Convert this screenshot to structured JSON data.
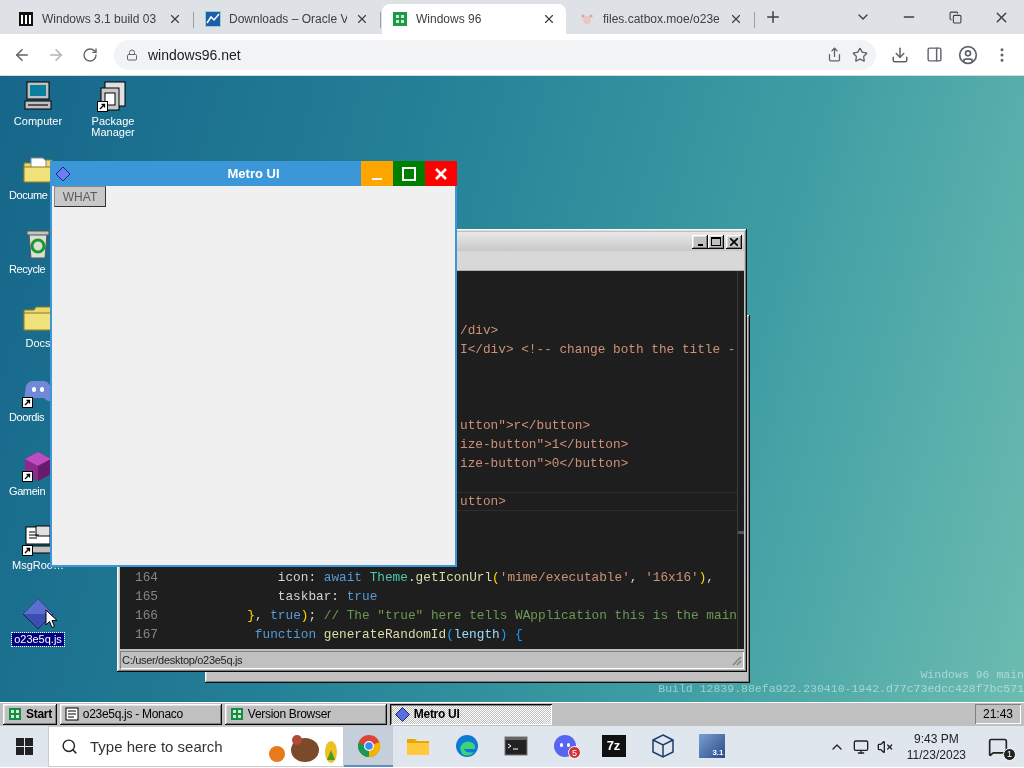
{
  "browser": {
    "tabs": [
      {
        "title": "Windows 3.1 build 03",
        "selected": false,
        "kind": "columns"
      },
      {
        "title": "Downloads – Oracle V",
        "selected": false,
        "kind": "chart"
      },
      {
        "title": "Windows 96",
        "selected": true,
        "kind": "grid"
      },
      {
        "title": "files.catbox.moe/o23e",
        "selected": false,
        "kind": "blob"
      }
    ],
    "url": "windows96.net"
  },
  "desktop": {
    "icons": [
      {
        "label": "Computer",
        "kind": "computer",
        "selected": false,
        "shortcut": false
      },
      {
        "label": "Package Manager",
        "kind": "package",
        "selected": false,
        "shortcut": true
      },
      {
        "label": "Docume",
        "kind": "docfolder",
        "selected": false,
        "shortcut": false
      },
      {
        "label": "Recycle",
        "kind": "recycle",
        "selected": false,
        "shortcut": false
      },
      {
        "label": "Docs",
        "kind": "folder",
        "selected": false,
        "shortcut": false
      },
      {
        "label": "Doordis",
        "kind": "chat",
        "selected": false,
        "shortcut": true
      },
      {
        "label": "Gamein",
        "kind": "cube",
        "selected": false,
        "shortcut": true
      },
      {
        "label": "MsgRoo…",
        "kind": "terminal",
        "selected": false,
        "shortcut": true
      },
      {
        "label": "o23e5q.js",
        "kind": "diamond",
        "selected": true,
        "shortcut": false
      }
    ],
    "version": [
      "Windows 96 main",
      "Build 12839.88efa922.230410-1942.d77c73edcc428f7bc571"
    ]
  },
  "editor_window": {
    "status": "C:/user/desktop/o23e5q.js",
    "lines": [
      {
        "current": false
      },
      {
        "current": false
      },
      {
        "current": false
      },
      {
        "current": false,
        "tokens": [
          {
            "text": "/div>",
            "kind": "string"
          }
        ]
      },
      {
        "current": false,
        "tokens": [
          {
            "text": "I</div> <!-- change both the title -",
            "kind": "string"
          }
        ]
      },
      {
        "current": false
      },
      {
        "current": false
      },
      {
        "current": false
      },
      {
        "current": false,
        "tokens": [
          {
            "text": "utton\">r</button>",
            "kind": "string"
          }
        ]
      },
      {
        "current": false,
        "tokens": [
          {
            "text": "ize-button\">1</button>",
            "kind": "string"
          }
        ]
      },
      {
        "current": false,
        "tokens": [
          {
            "text": "ize-button\">0</button>",
            "kind": "string"
          }
        ]
      },
      {
        "current": false
      },
      {
        "current": true,
        "tokens": [
          {
            "text": "utton>",
            "kind": "string"
          }
        ]
      },
      {
        "current": false
      },
      {
        "current": false
      },
      {
        "current": false
      },
      {
        "current": false,
        "number": "164",
        "tokens": [
          {
            "text": "            icon: ",
            "kind": "plain"
          },
          {
            "text": "await ",
            "kind": "keyword"
          },
          {
            "text": "Theme",
            "kind": "type"
          },
          {
            "text": ".getIconUrl",
            "kind": "func"
          },
          {
            "text": "(",
            "kind": "bracket"
          },
          {
            "text": "'mime/executable'",
            "kind": "string"
          },
          {
            "text": ", ",
            "kind": "plain"
          },
          {
            "text": "'16x16'",
            "kind": "string"
          },
          {
            "text": ")",
            "kind": "bracket"
          },
          {
            "text": ",",
            "kind": "plain"
          }
        ]
      },
      {
        "current": false,
        "number": "165",
        "tokens": [
          {
            "text": "            taskbar: ",
            "kind": "plain"
          },
          {
            "text": "true",
            "kind": "keyword"
          }
        ]
      },
      {
        "current": false,
        "number": "166",
        "tokens": [
          {
            "text": "        }",
            "kind": "bracket"
          },
          {
            "text": ", ",
            "kind": "plain"
          },
          {
            "text": "true",
            "kind": "keyword"
          },
          {
            "text": ")",
            "kind": "bracket"
          },
          {
            "text": "; ",
            "kind": "plain"
          },
          {
            "text": "// The \"true\" here tells WApplication this is the main",
            "kind": "comment"
          }
        ]
      },
      {
        "current": false,
        "number": "167",
        "tokens": [
          {
            "text": "         function",
            "kind": "keyword"
          },
          {
            "text": " generateRandomId",
            "kind": "func"
          },
          {
            "text": "(",
            "kind": "bracket2"
          },
          {
            "text": "length",
            "kind": "param"
          },
          {
            "text": ")",
            "kind": "bracket2"
          },
          {
            "text": " {",
            "kind": "bracket2"
          }
        ]
      }
    ]
  },
  "metro_window": {
    "title": "Metro UI",
    "button": "WHAT"
  },
  "win96_taskbar": {
    "start": "Start",
    "tasks": [
      {
        "label": "o23e5q.js - Monaco",
        "selected": false,
        "kind": "monaco"
      },
      {
        "label": "Version Browser",
        "selected": false,
        "kind": "grid"
      },
      {
        "label": "Metro UI",
        "selected": true,
        "kind": "diamond"
      }
    ],
    "clock": "21:43"
  },
  "windows_taskbar": {
    "search": {
      "placeholder": "Type here to search"
    },
    "apps": [
      {
        "kind": "chrome",
        "selected": true
      },
      {
        "kind": "folder",
        "selected": false
      },
      {
        "kind": "edge",
        "selected": false
      },
      {
        "kind": "terminal",
        "selected": false
      },
      {
        "kind": "discord",
        "selected": false,
        "badge": "5"
      },
      {
        "kind": "archive",
        "selected": false,
        "label": "7z"
      },
      {
        "kind": "cube",
        "selected": false
      },
      {
        "kind": "vm",
        "selected": false,
        "label": "3.1"
      }
    ],
    "time": "9:43 PM",
    "date": "11/23/2023",
    "notifications": "1"
  }
}
